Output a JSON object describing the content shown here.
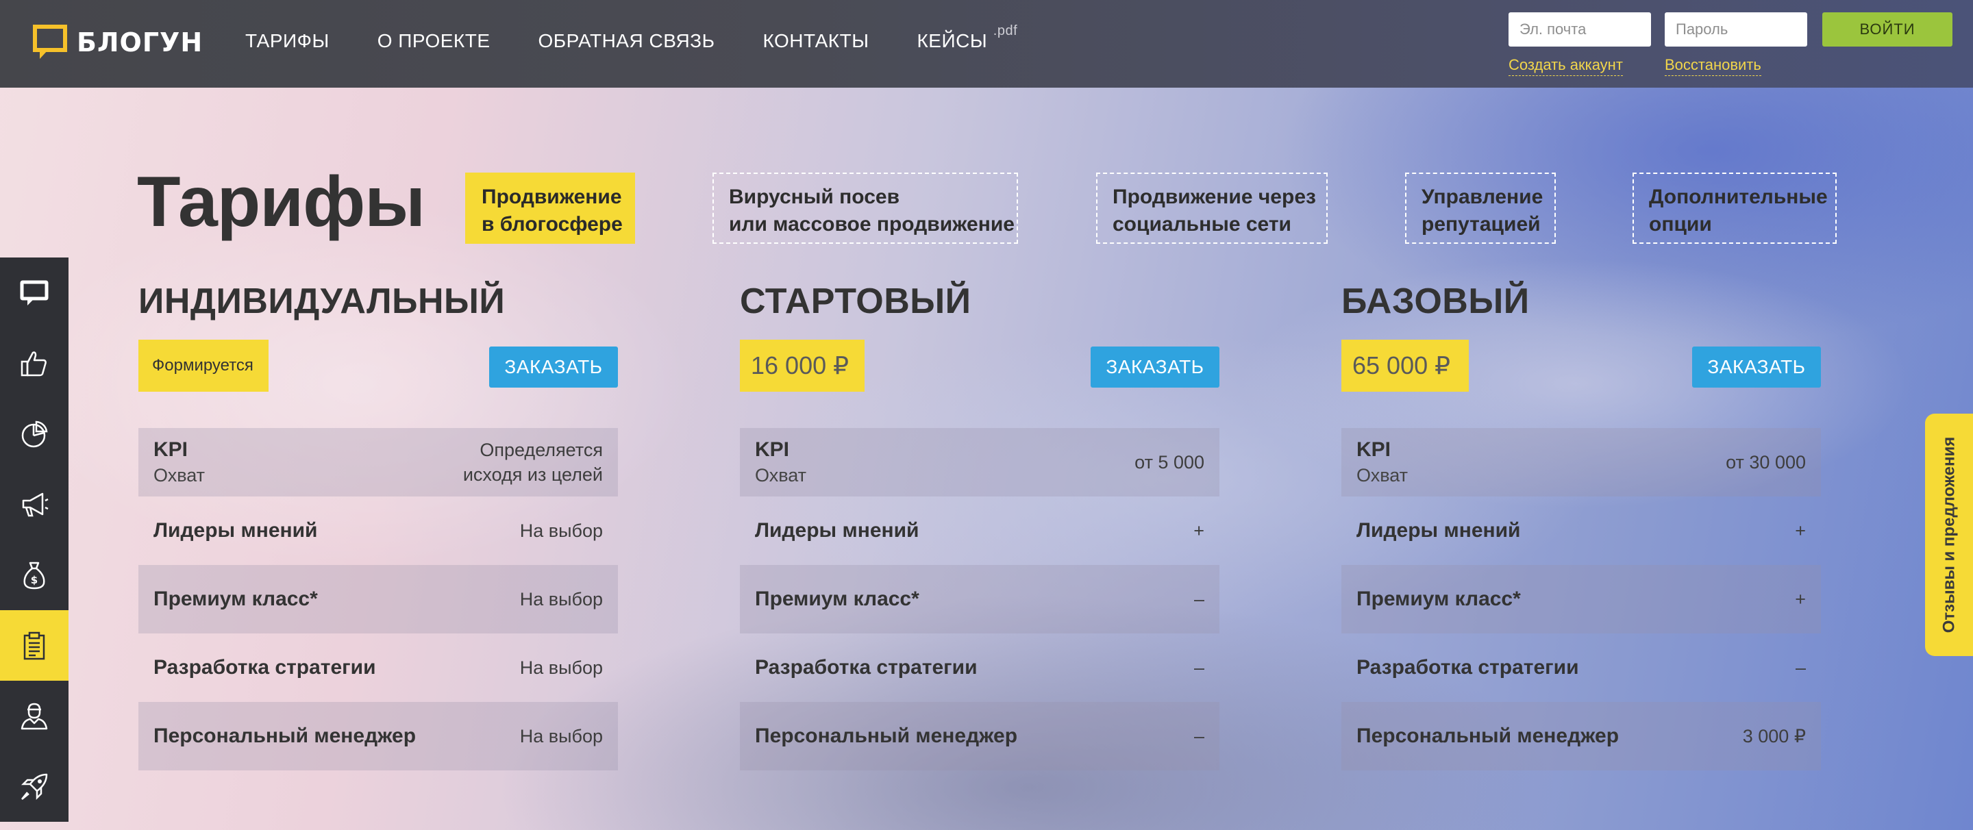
{
  "header": {
    "logo_text": "БЛОГУН",
    "nav": [
      {
        "label": "ТАРИФЫ"
      },
      {
        "label": "О ПРОЕКТЕ"
      },
      {
        "label": "ОБРАТНАЯ СВЯЗЬ"
      },
      {
        "label": "КОНТАКТЫ"
      },
      {
        "label": "КЕЙСЫ",
        "sup": ".pdf"
      }
    ],
    "email_placeholder": "Эл. почта",
    "password_placeholder": "Пароль",
    "login_label": "ВОЙТИ",
    "create_account": "Создать аккаунт",
    "restore": "Восстановить"
  },
  "sidebar": {
    "icons": [
      "chat-icon",
      "thumbs-up-icon",
      "pie-chart-icon",
      "megaphone-icon",
      "money-bag-icon",
      "clipboard-icon",
      "user-icon",
      "rocket-icon"
    ],
    "active_index": 5
  },
  "feedback_tab": "Отзывы и предложения",
  "main": {
    "title": "Тарифы",
    "categories": [
      {
        "line1": "Продвижение",
        "line2": "в блогосфере",
        "active": true
      },
      {
        "line1": "Вирусный посев",
        "line2": "или массовое продвижение",
        "active": false
      },
      {
        "line1": "Продвижение через",
        "line2": "социальные сети",
        "active": false
      },
      {
        "line1": "Управление",
        "line2": "репутацией",
        "active": false
      },
      {
        "line1": "Дополнительные",
        "line2": "опции",
        "active": false
      }
    ],
    "order_label": "ЗАКАЗАТЬ",
    "row_labels": {
      "kpi": "KPI",
      "reach": "Охват",
      "leaders": "Лидеры мнений",
      "premium": "Премиум класс*",
      "strategy": "Разработка стратегии",
      "manager": "Персональный менеджер"
    },
    "plans": [
      {
        "name": "ИНДИВИДУАЛЬНЫЙ",
        "price": "Формируется",
        "kpi_line1": "Определяется",
        "kpi_line2": "исходя из целей",
        "leaders": "На выбор",
        "premium": "На выбор",
        "strategy": "На выбор",
        "manager": "На выбор"
      },
      {
        "name": "СТАРТОВЫЙ",
        "price": "16 000 ₽",
        "kpi_line1": "от 5 000",
        "kpi_line2": "",
        "leaders": "+",
        "premium": "–",
        "strategy": "–",
        "manager": "–"
      },
      {
        "name": "БАЗОВЫЙ",
        "price": "65 000 ₽",
        "kpi_line1": "от 30 000",
        "kpi_line2": "",
        "leaders": "+",
        "premium": "+",
        "strategy": "–",
        "manager": "3 000 ₽"
      }
    ]
  },
  "colors": {
    "accent_yellow": "#f6da36",
    "button_blue": "#2fa3df",
    "login_green": "#9bc53d",
    "header_dark": "#45464b",
    "sidebar_dark": "#2f3035"
  }
}
